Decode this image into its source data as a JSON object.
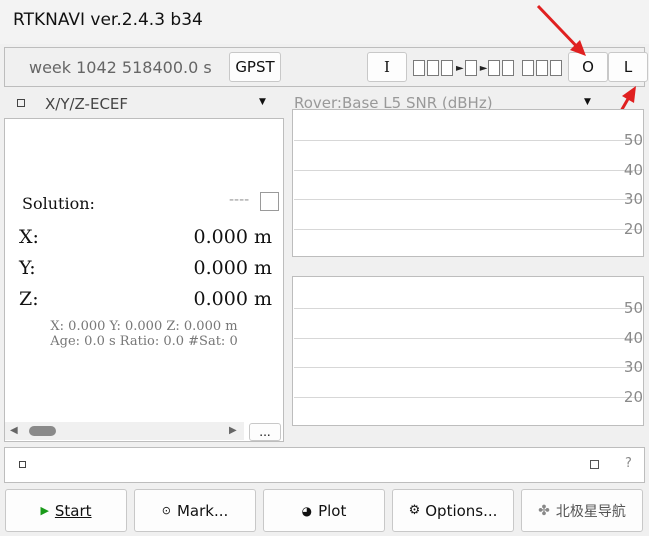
{
  "window": {
    "title": "RTKNAVI ver.2.4.3 b34"
  },
  "toolbar": {
    "time": "week 1042 518400.0 s",
    "timesys": "GPST",
    "input_label": "I",
    "output_label": "O",
    "log_label": "L"
  },
  "left": {
    "dropdown": "X/Y/Z-ECEF",
    "solution_label": "Solution:",
    "solution_status": "----",
    "rows": [
      {
        "label": "X:",
        "value": "0.000 m"
      },
      {
        "label": "Y:",
        "value": "0.000 m"
      },
      {
        "label": "Z:",
        "value": "0.000 m"
      }
    ],
    "summary1": "X: 0.000 Y: 0.000 Z: 0.000 m",
    "summary2": "Age: 0.0 s Ratio: 0.0 #Sat: 0",
    "more": "..."
  },
  "right": {
    "dropdown": "Rover:Base L5 SNR (dBHz)"
  },
  "chart_data": [
    {
      "type": "bar",
      "yticks": [
        20,
        30,
        40,
        50
      ],
      "ylim": [
        10,
        60
      ],
      "series": []
    },
    {
      "type": "bar",
      "yticks": [
        20,
        30,
        40,
        50
      ],
      "ylim": [
        10,
        60
      ],
      "series": []
    }
  ],
  "status": {
    "help": "?"
  },
  "buttons": {
    "start": "Start",
    "mark": "Mark...",
    "plot": "Plot",
    "options": "Options...",
    "exit": "北极星导航"
  },
  "colors": {
    "arrow": "#e02020",
    "start_icon": "#1a9a1a"
  }
}
